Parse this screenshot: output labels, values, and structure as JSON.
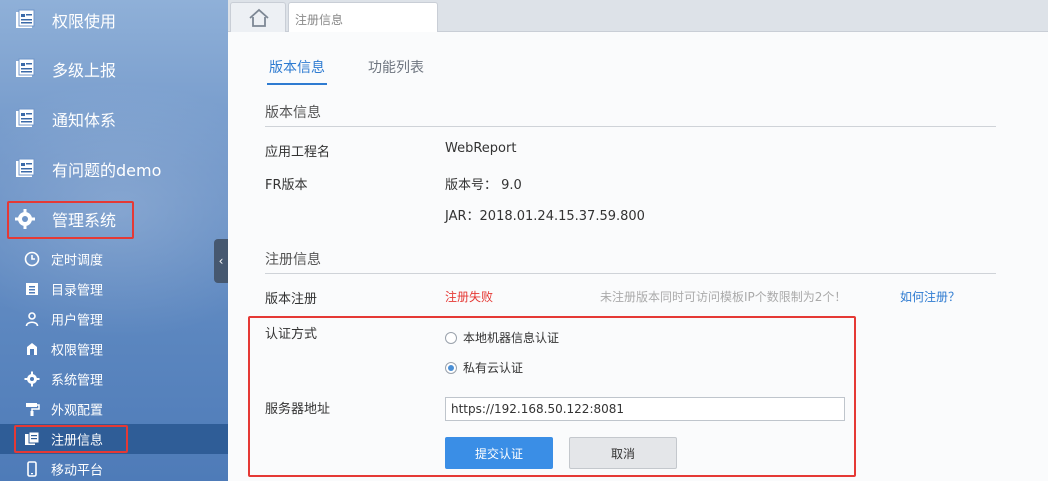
{
  "sidebar": {
    "main_items": [
      {
        "label": "权限使用",
        "icon": "report-icon"
      },
      {
        "label": "多级上报",
        "icon": "report-icon"
      },
      {
        "label": "通知体系",
        "icon": "report-icon"
      },
      {
        "label": "有问题的demo",
        "icon": "report-icon"
      },
      {
        "label": "管理系统",
        "icon": "gear-icon"
      }
    ],
    "sub_items": [
      {
        "label": "定时调度",
        "icon": "clock-icon"
      },
      {
        "label": "目录管理",
        "icon": "folder-icon"
      },
      {
        "label": "用户管理",
        "icon": "user-icon"
      },
      {
        "label": "权限管理",
        "icon": "permission-icon"
      },
      {
        "label": "系统管理",
        "icon": "settings-icon"
      },
      {
        "label": "外观配置",
        "icon": "paint-roller-icon"
      },
      {
        "label": "注册信息",
        "icon": "register-icon"
      },
      {
        "label": "移动平台",
        "icon": "mobile-icon"
      }
    ],
    "collapse_glyph": "‹"
  },
  "tabs": {
    "home_icon": "home-icon",
    "active_label": "注册信息"
  },
  "content": {
    "subtabs": [
      "版本信息",
      "功能列表"
    ],
    "version_section_title": "版本信息",
    "app_name_label": "应用工程名",
    "app_name_value": "WebReport",
    "fr_version_label": "FR版本",
    "fr_version_value": "版本号：  9.0",
    "jar_value": "JAR：2018.01.24.15.37.59.800",
    "register_section_title": "注册信息",
    "version_register_label": "版本注册",
    "register_status": "注册失败",
    "register_hint": "未注册版本同时可访问模板IP个数限制为2个！",
    "help_link": "如何注册？",
    "auth_method_label": "认证方式",
    "auth_options": [
      "本地机器信息认证",
      "私有云认证"
    ],
    "auth_selected": "私有云认证",
    "server_address_label": "服务器地址",
    "server_address_value": "https://192.168.50.122:8081",
    "submit_label": "提交认证",
    "cancel_label": "取消"
  },
  "colors": {
    "accent": "#2e7bd1",
    "highlight_box": "#e53935",
    "error": "#e53935",
    "sidebar_active": "#2f5d97",
    "submit": "#3a8ee6"
  }
}
